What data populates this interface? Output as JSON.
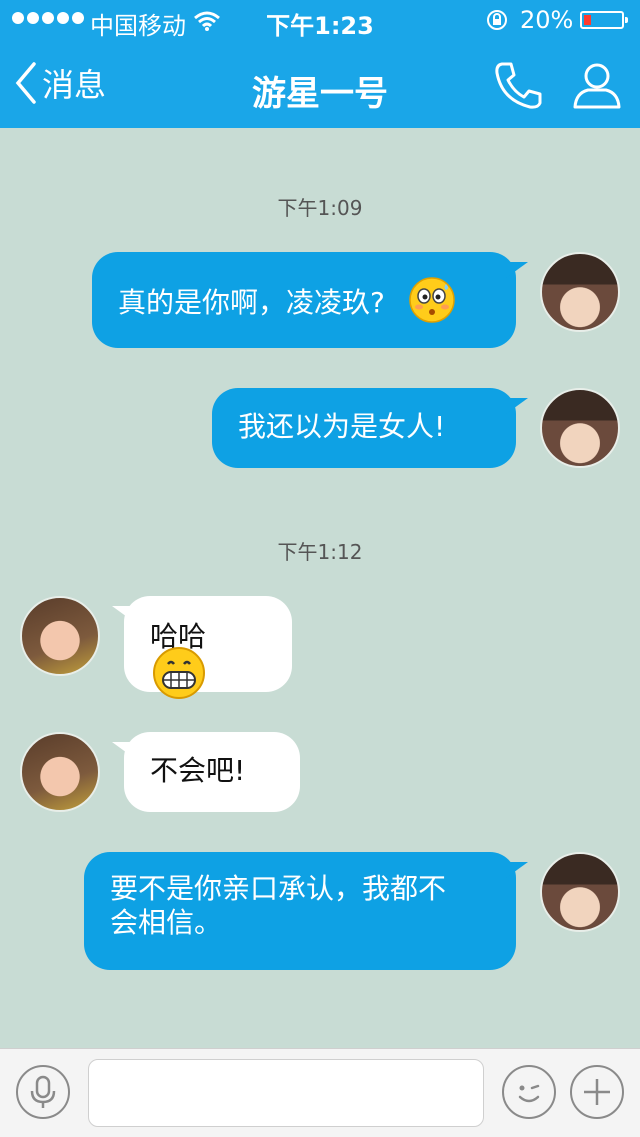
{
  "status_bar": {
    "carrier": "中国移动",
    "time": "下午1:23",
    "battery": "20%",
    "battery_level": 0.2,
    "signal_icon": "signal-dots-icon",
    "wifi_icon": "wifi-icon",
    "lock_icon": "rotation-lock-icon"
  },
  "nav": {
    "back_label": "消息",
    "title": "游星一号",
    "call_icon": "phone-icon",
    "profile_icon": "person-icon"
  },
  "messages": [
    {
      "type": "timestamp",
      "text": "下午1:09"
    },
    {
      "type": "outgoing",
      "text": "真的是你啊，凌凌玖?",
      "emoji": "surprised-emoji"
    },
    {
      "type": "outgoing",
      "text": "我还以为是女人!"
    },
    {
      "type": "timestamp",
      "text": "下午1:12"
    },
    {
      "type": "incoming",
      "text": "哈哈",
      "emoji": "grin-emoji"
    },
    {
      "type": "incoming",
      "text": "不会吧!"
    },
    {
      "type": "outgoing",
      "text_line1": "要不是你亲口承认，我都不",
      "text_line2": "会相信。"
    }
  ],
  "input_bar": {
    "placeholder": "",
    "voice_icon": "microphone-icon",
    "emoji_icon": "wink-face-icon",
    "more_icon": "plus-icon"
  },
  "colors": {
    "header": "#1aa6e8",
    "chat_background": "#c8dcd4",
    "outgoing_bubble": "#0ea1e4",
    "incoming_bubble": "#ffffff"
  }
}
